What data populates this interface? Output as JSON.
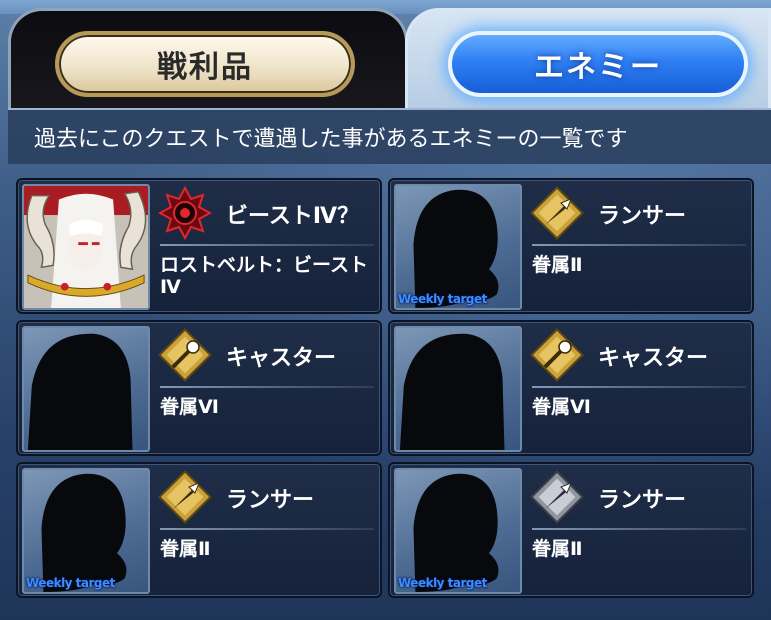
{
  "tabs": {
    "loot_label": "戦利品",
    "enemy_label": "エネミー"
  },
  "description": "過去にこのクエストで遭遇した事があるエネミーの一覧です",
  "weekly_label": "Weekly target",
  "enemies": [
    {
      "class_name": "ビーストⅣ？",
      "name": "ロストベルト：ビーストⅣ",
      "class_icon": "beast-icon",
      "portrait": "beast-portrait",
      "weekly": false
    },
    {
      "class_name": "ランサー",
      "name": "眷属Ⅱ",
      "class_icon": "lancer-gold-icon",
      "portrait": "silhouette",
      "weekly": true
    },
    {
      "class_name": "キャスター",
      "name": "眷属Ⅵ",
      "class_icon": "caster-gold-icon",
      "portrait": "silhouette",
      "weekly": false
    },
    {
      "class_name": "キャスター",
      "name": "眷属Ⅵ",
      "class_icon": "caster-gold-icon",
      "portrait": "silhouette",
      "weekly": false
    },
    {
      "class_name": "ランサー",
      "name": "眷属Ⅱ",
      "class_icon": "lancer-gold-icon",
      "portrait": "silhouette",
      "weekly": true
    },
    {
      "class_name": "ランサー",
      "name": "眷属Ⅱ",
      "class_icon": "lancer-silver-icon",
      "portrait": "silhouette",
      "weekly": true
    }
  ],
  "colors": {
    "enemy_tab_accent": "#2f7ff3",
    "weekly_text": "#3f8cff",
    "beast_icon": "#c21a24",
    "gold_icon": "#c9a23c",
    "silver_icon": "#8f96a0"
  }
}
